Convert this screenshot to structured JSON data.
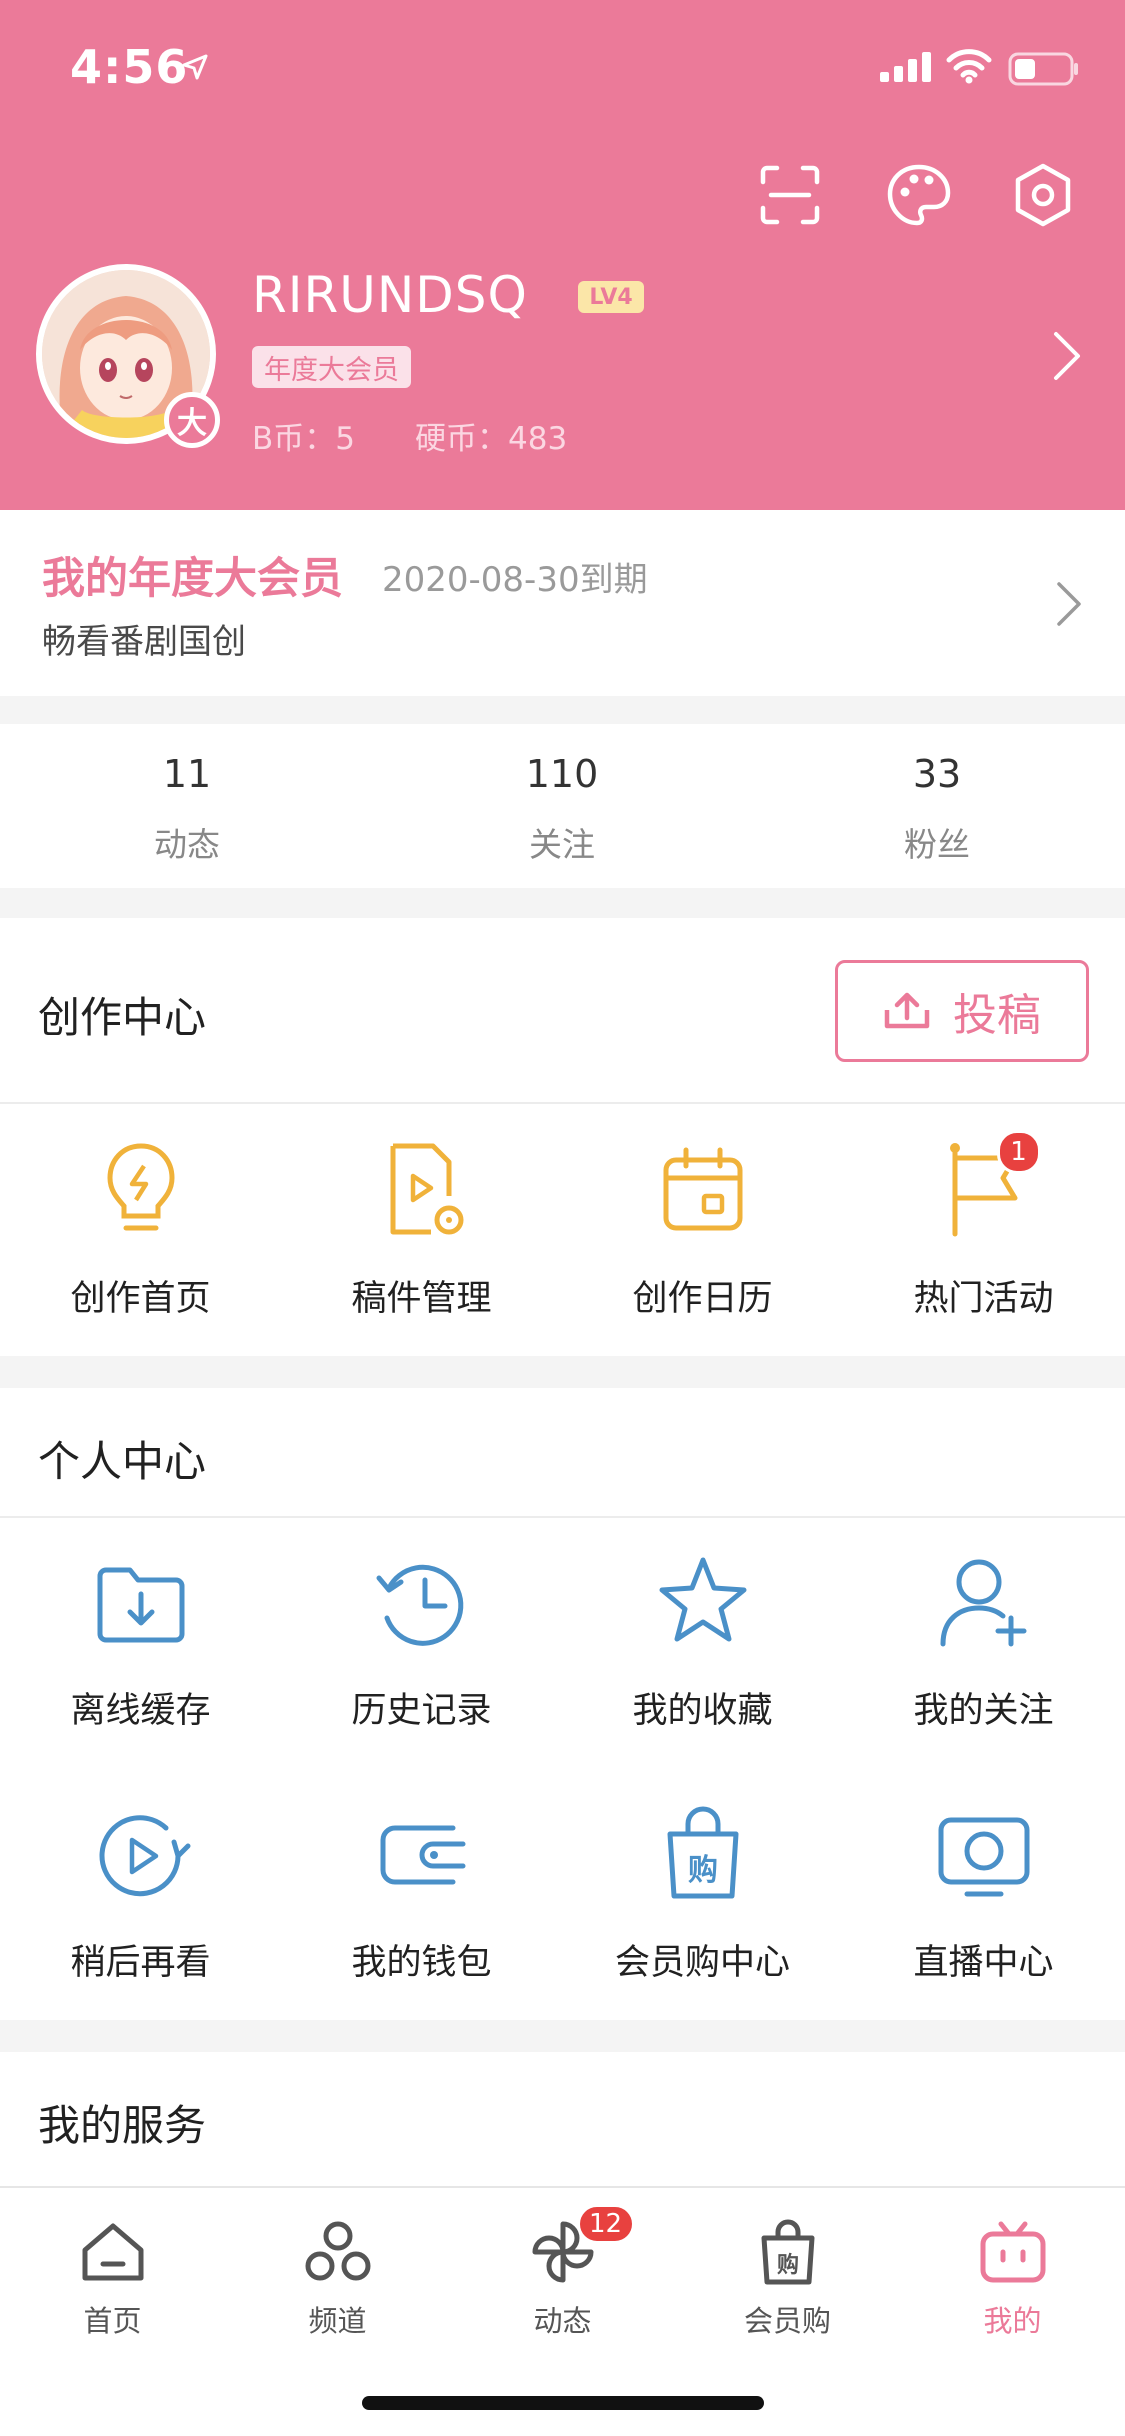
{
  "status_bar": {
    "time": "4:56"
  },
  "profile": {
    "username": "RIRUNDSQ",
    "level": "LV4",
    "vip_tag": "年度大会员",
    "avatar_badge": "大",
    "b_coin": "B币：5",
    "coin": "硬币：483"
  },
  "vip": {
    "title": "我的年度大会员",
    "expire": "2020-08-30到期",
    "subtitle": "畅看番剧国创"
  },
  "stats": [
    {
      "value": "11",
      "label": "动态"
    },
    {
      "value": "110",
      "label": "关注"
    },
    {
      "value": "33",
      "label": "粉丝"
    }
  ],
  "creation": {
    "title": "创作中心",
    "submit_label": "投稿",
    "items": [
      {
        "label": "创作首页",
        "icon": "lightbulb-icon"
      },
      {
        "label": "稿件管理",
        "icon": "document-video-icon"
      },
      {
        "label": "创作日历",
        "icon": "calendar-icon"
      },
      {
        "label": "热门活动",
        "icon": "flag-icon",
        "badge": "1"
      }
    ]
  },
  "personal": {
    "title": "个人中心",
    "items": [
      {
        "label": "离线缓存",
        "icon": "download-folder-icon"
      },
      {
        "label": "历史记录",
        "icon": "history-clock-icon"
      },
      {
        "label": "我的收藏",
        "icon": "star-icon"
      },
      {
        "label": "我的关注",
        "icon": "add-user-icon"
      },
      {
        "label": "稍后再看",
        "icon": "watch-later-icon"
      },
      {
        "label": "我的钱包",
        "icon": "wallet-icon"
      },
      {
        "label": "会员购中心",
        "icon": "shopping-bag-icon"
      },
      {
        "label": "直播中心",
        "icon": "live-tv-icon"
      }
    ]
  },
  "services": {
    "title": "我的服务"
  },
  "tabbar": [
    {
      "label": "首页",
      "icon": "home-icon"
    },
    {
      "label": "频道",
      "icon": "channel-icon"
    },
    {
      "label": "动态",
      "icon": "pinwheel-icon",
      "badge": "12"
    },
    {
      "label": "会员购",
      "icon": "shopping-bag-icon"
    },
    {
      "label": "我的",
      "icon": "tv-mascot-icon",
      "active": true
    }
  ],
  "colors": {
    "brand_pink": "#eb7a99",
    "icon_blue": "#4a90c8",
    "icon_yellow": "#f0b23a",
    "badge_red": "#e8413f"
  }
}
